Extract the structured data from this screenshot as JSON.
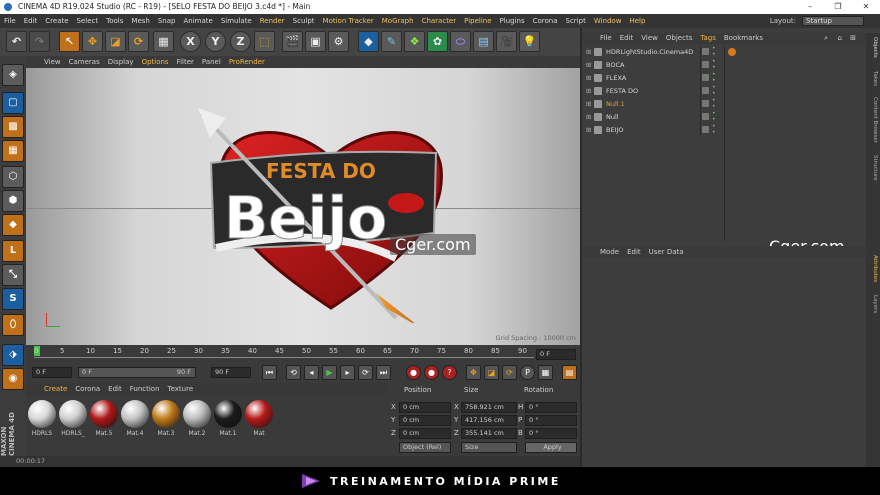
{
  "window": {
    "title": "CINEMA 4D R19.024 Studio (RC - R19) - [SELO FESTA DO BEIJO 3.c4d *] - Main",
    "controls": [
      "–",
      "❐",
      "✕"
    ]
  },
  "menubar": {
    "items": [
      "File",
      "Edit",
      "Create",
      "Select",
      "Tools",
      "Mesh",
      "Snap",
      "Animate",
      "Simulate",
      "Render",
      "Sculpt",
      "Motion Tracker",
      "MoGraph",
      "Character",
      "Pipeline",
      "Plugins",
      "Corona",
      "Script",
      "Window",
      "Help"
    ],
    "layout_label": "Layout:",
    "layout_value": "Startup"
  },
  "toolbar": {
    "axis_x": "X",
    "axis_y": "Y",
    "axis_z": "Z"
  },
  "viewport": {
    "menu": [
      "View",
      "Cameras",
      "Display",
      "Options",
      "Filter",
      "Panel",
      "ProRender"
    ],
    "grid_spacing": "Grid Spacing : 10000 cm",
    "watermark": "Cger.com",
    "logo_line1": "FESTA DO",
    "logo_line2": "Beijo"
  },
  "timeline": {
    "ticks": [
      "0",
      "5",
      "10",
      "15",
      "20",
      "25",
      "30",
      "35",
      "40",
      "45",
      "50",
      "55",
      "60",
      "65",
      "70",
      "75",
      "80",
      "85",
      "90"
    ],
    "end_frame": "0 F",
    "current_frame": "0 F",
    "start_field": "0 F",
    "end_field": "90 F",
    "end_field2": "90 F"
  },
  "materials": {
    "tabs": [
      "Create",
      "Corona",
      "Edit",
      "Function",
      "Texture"
    ],
    "items": [
      {
        "name": "HDRLS",
        "color": "#d8d8d8"
      },
      {
        "name": "HDRLS_",
        "color": "#cfcfcf"
      },
      {
        "name": "Mat.5",
        "color": "#b01818"
      },
      {
        "name": "Mat.4",
        "color": "#c4c4c4"
      },
      {
        "name": "Mat.3",
        "color": "#c07a1a"
      },
      {
        "name": "Mat.2",
        "color": "#bdbdbd"
      },
      {
        "name": "Mat.1",
        "color": "#1a1a1a"
      },
      {
        "name": "Mat",
        "color": "#b81a1a"
      }
    ]
  },
  "coordinates": {
    "headers": [
      "Position",
      "Size",
      "Rotation"
    ],
    "rows": [
      {
        "axis": "X",
        "pos": "0 cm",
        "size_axis": "X",
        "size": "758.921 cm",
        "rot_axis": "H",
        "rot": "0 °"
      },
      {
        "axis": "Y",
        "pos": "0 cm",
        "size_axis": "Y",
        "size": "417.156 cm",
        "rot_axis": "P",
        "rot": "0 °"
      },
      {
        "axis": "Z",
        "pos": "0 cm",
        "size_axis": "Z",
        "size": "355.141 cm",
        "rot_axis": "B",
        "rot": "0 °"
      }
    ],
    "mode": "Object (Rel)",
    "size_mode": "Size",
    "apply": "Apply"
  },
  "status": {
    "time": "00:00:17"
  },
  "objects": {
    "menu": [
      "File",
      "Edit",
      "View",
      "Objects",
      "Tags",
      "Bookmarks"
    ],
    "items": [
      {
        "name": "HDRLightStudio.Cinema4D",
        "color": "#d8d8d8"
      },
      {
        "name": "BOCA",
        "color": "#d8d8d8"
      },
      {
        "name": "FLEXA",
        "color": "#d8d8d8"
      },
      {
        "name": "FESTA DO",
        "color": "#d8d8d8"
      },
      {
        "name": "Null.1",
        "color": "#e0a040"
      },
      {
        "name": "Null",
        "color": "#d8d8d8"
      },
      {
        "name": "BEIJO",
        "color": "#d8d8d8"
      }
    ]
  },
  "attributes": {
    "menu": [
      "Mode",
      "Edit",
      "User Data"
    ]
  },
  "side_tabs": [
    "Objects",
    "Takes",
    "Content Browser",
    "Structure",
    "Attributes",
    "Layers"
  ],
  "left_logo": "MAXON CINEMA 4D",
  "banner": {
    "text": "TREINAMENTO MÍDIA PRIME"
  }
}
